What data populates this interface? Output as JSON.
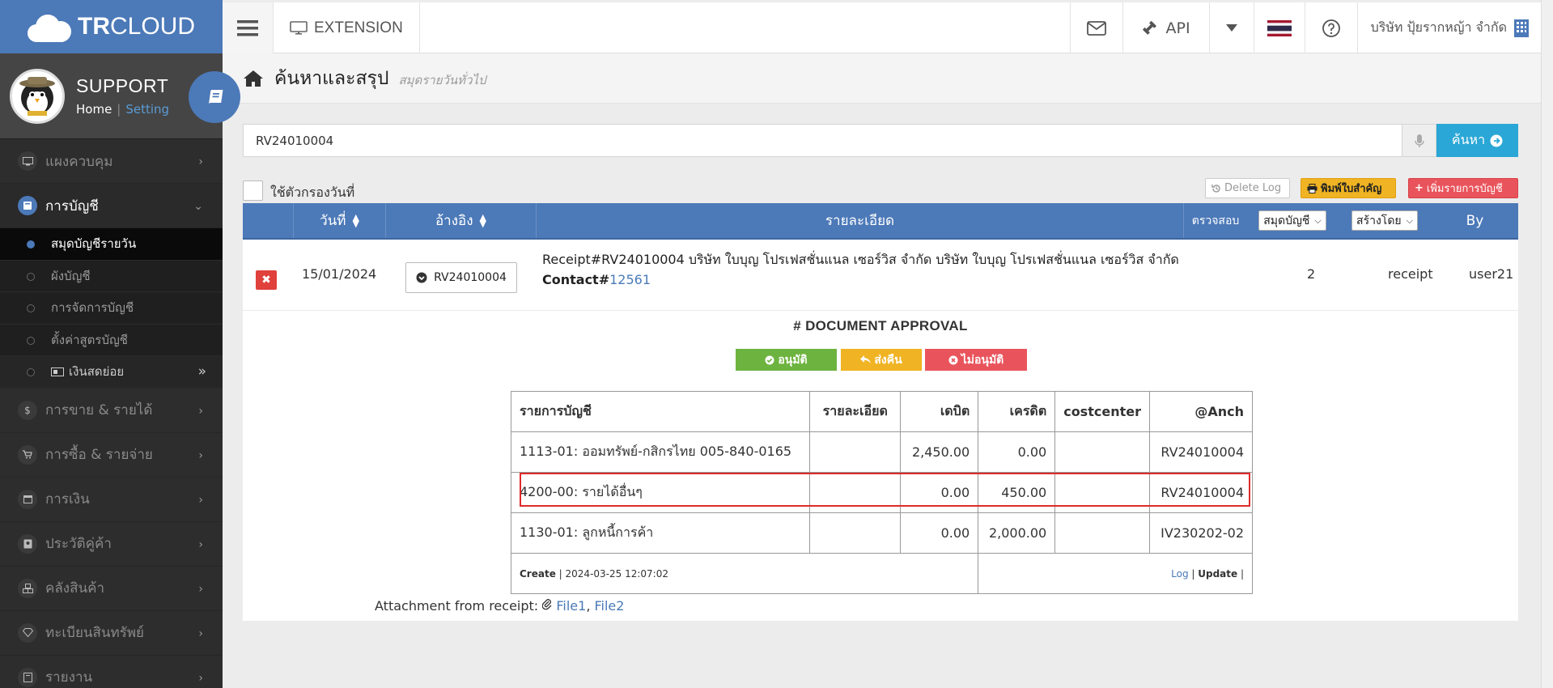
{
  "brand": {
    "strong": "TR",
    "rest": "CLOUD"
  },
  "profile": {
    "name": "SUPPORT",
    "home": "Home",
    "sep": "|",
    "setting": "Setting"
  },
  "sidebar": {
    "items": [
      {
        "label": "แผงควบคุม"
      },
      {
        "label": "การบัญชี"
      },
      {
        "label": "การขาย & รายได้"
      },
      {
        "label": "การซื้อ & รายจ่าย"
      },
      {
        "label": "การเงิน"
      },
      {
        "label": "ประวัติคู่ค้า"
      },
      {
        "label": "คลังสินค้า"
      },
      {
        "label": "ทะเบียนสินทรัพย์"
      },
      {
        "label": "รายงาน"
      }
    ],
    "sub": [
      {
        "label": "สมุดบัญชีรายวัน"
      },
      {
        "label": "ผังบัญชี"
      },
      {
        "label": "การจัดการบัญชี"
      },
      {
        "label": "ตั้งค่าสูตรบัญชี"
      },
      {
        "label": "เงินสดย่อย"
      }
    ]
  },
  "topnav": {
    "extension": "EXTENSION",
    "api": "API",
    "company": "บริษัท ปุ้ยรากหญ้า จำกัด"
  },
  "header": {
    "title": "ค้นหาและสรุป",
    "subtitle": "สมุดรายวันทั่วไป"
  },
  "search": {
    "value": "RV24010004",
    "button": "ค้นหา"
  },
  "filter": {
    "label": "ใช้ตัวกรองวันที่"
  },
  "actions": {
    "delete_log": "Delete Log",
    "print": "พิมพ์ใบสำคัญ",
    "add": "เพิ่มรายการบัญชี"
  },
  "table": {
    "headers": {
      "date": "วันที่",
      "ref": "อ้างอิง",
      "detail": "รายละเอียด",
      "check": "ตรวจสอบ",
      "book": "สมุดบัญชี",
      "created_by": "สร้างโดย",
      "by": "By"
    },
    "row": {
      "date": "15/01/2024",
      "ref": "RV24010004",
      "detail": "Receipt#RV24010004 บริษัท ใบบุญ โปรเฟสชั่นแนล เซอร์วิส จำกัด บริษัท ใบบุญ โปรเฟสชั่นแนล เซอร์วิส จำกัด",
      "contact_label": "Contact#",
      "contact_id": "12561",
      "check": "2",
      "book": "receipt",
      "by": "user21"
    }
  },
  "approval": {
    "title": "# DOCUMENT APPROVAL",
    "approve": "อนุมัติ",
    "return": "ส่งคืน",
    "reject": "ไม่อนุมัติ"
  },
  "ledger": {
    "headers": {
      "account": "รายการบัญชี",
      "detail": "รายละเอียด",
      "debit": "เดบิต",
      "credit": "เครดิต",
      "costcenter": "costcenter",
      "anch": "@Anch"
    },
    "rows": [
      {
        "account": "1113-01: ออมทรัพย์-กสิกรไทย 005-840-0165",
        "detail": "",
        "debit": "2,450.00",
        "credit": "0.00",
        "costcenter": "",
        "anch": "RV24010004"
      },
      {
        "account": "4200-00: รายได้อื่นๆ",
        "detail": "",
        "debit": "0.00",
        "credit": "450.00",
        "costcenter": "",
        "anch": "RV24010004"
      },
      {
        "account": "1130-01: ลูกหนี้การค้า",
        "detail": "",
        "debit": "0.00",
        "credit": "2,000.00",
        "costcenter": "",
        "anch": "IV230202-02"
      }
    ],
    "footer": {
      "create_label": "Create",
      "create_date": "| 2024-03-25 12:07:02",
      "log": "Log",
      "update": "Update"
    }
  },
  "attachment": {
    "label": "Attachment from receipt:",
    "file1": "File1",
    "file2": "File2"
  },
  "colors": {
    "primary": "#4c79b8",
    "success": "#6db33f",
    "warning": "#f0b323",
    "danger": "#e9545c",
    "info": "#2aa7d6",
    "highlight": "#e02a2a"
  }
}
